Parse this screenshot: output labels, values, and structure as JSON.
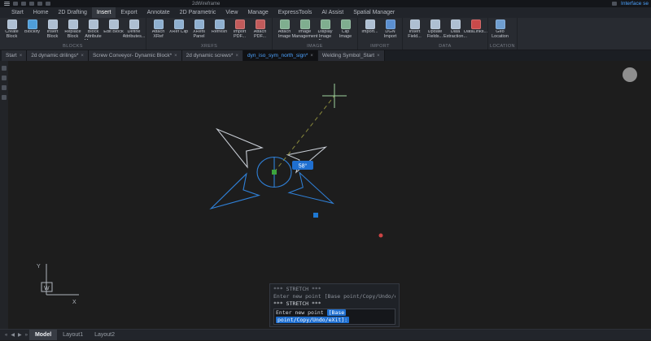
{
  "titlebar": {
    "viewport_label": "2dWireframe",
    "right_link": "Interface se"
  },
  "menubar": {
    "active_index": 3,
    "items": [
      "Start",
      "Home",
      "2D Drafting",
      "Insert",
      "Export",
      "Annotate",
      "2D Parametric",
      "View",
      "Manage",
      "ExpressTools",
      "AI Assist",
      "Spatial Manager"
    ]
  },
  "ribbon": {
    "groups": [
      {
        "label": "BLOCKS",
        "buttons": [
          {
            "label": "Create Block",
            "icon": "create-block-icon",
            "color": "#aebfd2"
          },
          {
            "label": "Blockify",
            "icon": "blockify-icon",
            "color": "#4f9ed9"
          },
          {
            "label": "Insert Block",
            "icon": "insert-block-icon",
            "color": "#aebfd2"
          },
          {
            "label": "Replace Block",
            "icon": "replace-block-icon",
            "color": "#aebfd2"
          },
          {
            "label": "Block Attribute Manager",
            "icon": "block-attribute-manager-icon",
            "color": "#aebfd2"
          },
          {
            "label": "Edit Block",
            "icon": "edit-block-icon",
            "color": "#aebfd2"
          },
          {
            "label": "Define Attributes...",
            "icon": "define-attributes-icon",
            "color": "#aebfd2"
          }
        ]
      },
      {
        "label": "XREFS",
        "buttons": [
          {
            "label": "Attach XRef",
            "icon": "attach-xref-icon",
            "color": "#8fb0d0"
          },
          {
            "label": "XRef Clip",
            "icon": "xref-clip-icon",
            "color": "#8fb0d0"
          },
          {
            "label": "XRefs Panel",
            "icon": "xrefs-panel-icon",
            "color": "#8fb0d0"
          },
          {
            "label": "Refresh",
            "icon": "refresh-icon",
            "color": "#8fb0d0"
          },
          {
            "label": "Import PDF...",
            "icon": "import-pdf-icon",
            "color": "#c25b5b"
          },
          {
            "label": "Attach PDF...",
            "icon": "attach-pdf-icon",
            "color": "#c25b5b"
          }
        ]
      },
      {
        "label": "IMAGE",
        "buttons": [
          {
            "label": "Attach Image",
            "icon": "attach-image-icon",
            "color": "#7fae8f"
          },
          {
            "label": "Image Management",
            "icon": "image-management-icon",
            "color": "#7fae8f"
          },
          {
            "label": "Display Image Frame",
            "icon": "display-image-frame-icon",
            "color": "#7fae8f"
          },
          {
            "label": "Clip Image",
            "icon": "clip-image-icon",
            "color": "#7fae8f"
          }
        ]
      },
      {
        "label": "IMPORT",
        "buttons": [
          {
            "label": "Import...",
            "icon": "import-icon",
            "color": "#aebfd2"
          },
          {
            "label": "DGN Import",
            "icon": "dgn-import-icon",
            "color": "#5b8fd0"
          }
        ]
      },
      {
        "label": "DATA",
        "buttons": [
          {
            "label": "Insert Field...",
            "icon": "insert-field-icon",
            "color": "#aebfd2"
          },
          {
            "label": "Update Fields...",
            "icon": "update-fields-icon",
            "color": "#aebfd2"
          },
          {
            "label": "Data Extraction...",
            "icon": "data-extraction-icon",
            "color": "#aebfd2"
          },
          {
            "label": "DataLinks...",
            "icon": "datalinks-icon",
            "color": "#c94a4a"
          }
        ]
      },
      {
        "label": "LOCATION",
        "buttons": [
          {
            "label": "Geo Location",
            "icon": "geo-location-icon",
            "color": "#6f9ed0"
          }
        ]
      }
    ]
  },
  "doc_tabs": {
    "active_index": 4,
    "close_glyph": "×",
    "tabs": [
      "Start",
      "2d dynamic drilings*",
      "Screw Conveyor- Dynamic Block*",
      "2d dynamic screws*",
      "dyn_iso_sym_north_sign*",
      "Welding Symbol_Start"
    ]
  },
  "canvas": {
    "angle_tooltip": "58°",
    "ucs": {
      "x_label": "X",
      "y_label": "Y",
      "origin_label": "W"
    }
  },
  "command": {
    "history": [
      "*** STRETCH ***",
      "Enter new point [Base point/Copy/Undo/eXit]:",
      "*** STRETCH ***"
    ],
    "prompt": "Enter new point",
    "option_first": "[Base",
    "option_wrap": "point/Copy/Undo/eXit]:"
  },
  "statusbar": {
    "active_index": 0,
    "nav_icons": [
      {
        "name": "first-tab-icon",
        "glyph": "«"
      },
      {
        "name": "prev-tab-icon",
        "glyph": "◀"
      },
      {
        "name": "next-tab-icon",
        "glyph": "▶"
      },
      {
        "name": "last-tab-icon",
        "glyph": "»"
      }
    ],
    "tabs": [
      "Model",
      "Layout1",
      "Layout2"
    ]
  },
  "side_toolbar": {
    "icons": [
      "panel-icon-1",
      "panel-icon-2",
      "panel-icon-3",
      "panel-icon-4"
    ]
  },
  "colors": {
    "accent_blue": "#2f80d8",
    "command_highlight": "#1f6fd0",
    "crosshair_green": "#9fd49f",
    "grip_green": "#3da43d",
    "grip_blue": "#1e78d2",
    "point_red": "#cc4444",
    "white_line": "#c9ced6",
    "rubber_band_olive": "#8a8a3c"
  }
}
